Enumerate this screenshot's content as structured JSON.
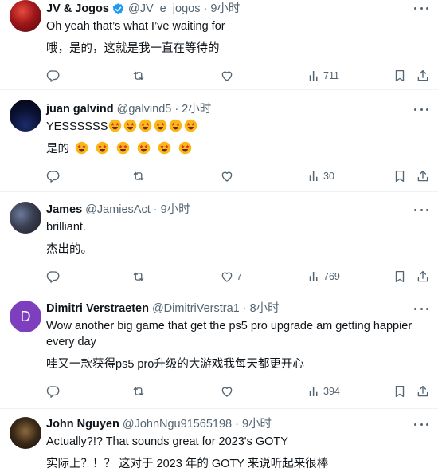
{
  "posts": [
    {
      "name": "JV & Jogos",
      "verified": true,
      "handle": "@JV_e_jogos",
      "time": "9小时",
      "line1": "Oh yeah that’s what I’ve waiting for",
      "line2": "哦，是的，这就是我一直在等待的",
      "likes": "",
      "views": "711"
    },
    {
      "name": "juan galvind",
      "verified": false,
      "handle": "@galvind5",
      "time": "2小时",
      "line1": "YESSSSSS",
      "line2": "是的",
      "line1_emoji": [
        "star-struck-emoji",
        "star-struck-emoji",
        "star-struck-emoji",
        "star-struck-emoji",
        "star-struck-emoji",
        "star-struck-emoji"
      ],
      "line2_emoji": [
        "star-struck-emoji",
        "star-struck-emoji",
        "star-struck-emoji",
        "star-struck-emoji",
        "star-struck-emoji",
        "star-struck-emoji"
      ],
      "likes": "",
      "views": "30"
    },
    {
      "name": "James",
      "verified": false,
      "handle": "@JamiesAct",
      "time": "9小时",
      "line1": "brilliant.",
      "line2": "杰出的。",
      "likes": "7",
      "views": "769"
    },
    {
      "name": "Dimitri Verstraeten",
      "verified": false,
      "handle": "@DimitriVerstra1",
      "time": "8小时",
      "avatar_letter": "D",
      "line1": "Wow another big game that get the ps5 pro upgrade am getting happier every day",
      "line2": "哇又一款获得ps5 pro升级的大游戏我每天都更开心",
      "likes": "",
      "views": "394"
    },
    {
      "name": "John Nguyen",
      "verified": false,
      "handle": "@JohnNgu91565198",
      "time": "9小时",
      "line1": "Actually?!? That sounds great for 2023's GOTY",
      "line2": "实际上？！？ 这对于 2023 年的 GOTY 来说听起来很棒"
    }
  ],
  "separator": "·",
  "colors": {
    "verified": "#1d9bf0",
    "secondary_text": "#536471",
    "divider": "#eff3f4",
    "dimitri_avatar": "#7e3fbf"
  }
}
